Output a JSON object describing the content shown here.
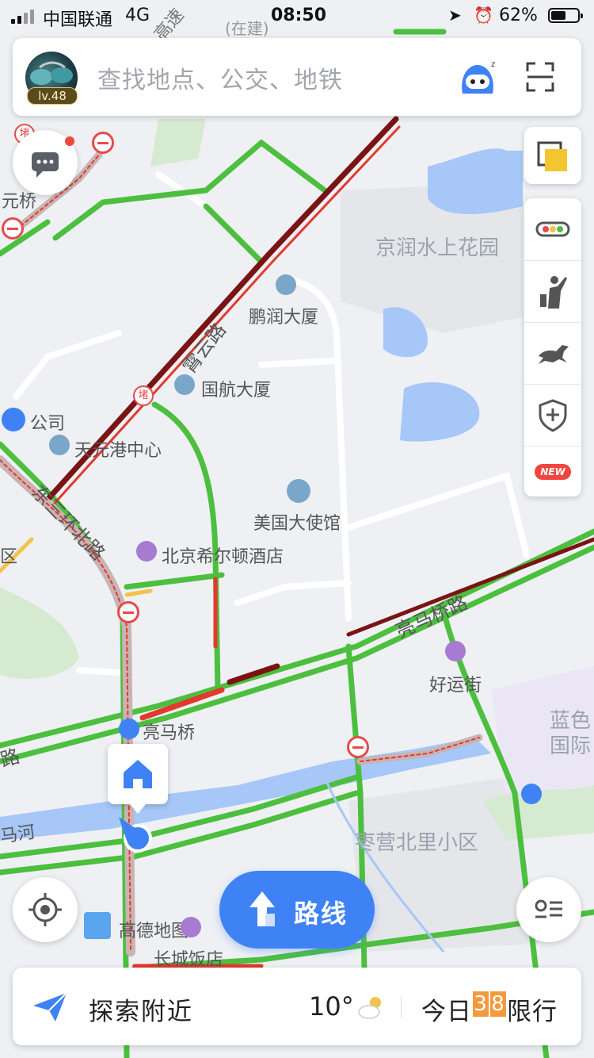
{
  "status_bar": {
    "carrier": "中国联通",
    "network": "4G",
    "time": "08:50",
    "battery_percent": "62%",
    "battery_level": 0.62
  },
  "search": {
    "placeholder": "查找地点、公交、地铁",
    "level_badge": "lv.48"
  },
  "map": {
    "road_labels": {
      "xiaoyun_road": "霄云路",
      "east_third_ring": "东三环北路",
      "liangmaqiao_road": "亮马桥路",
      "road_left": "路",
      "river": "马河",
      "top_left_qiao": "元桥",
      "top_speed": "高速",
      "construction": "(在建)",
      "left_qu": "区",
      "jam": "堵"
    },
    "pois": {
      "pengrun": "鹏润大厦",
      "guohang": "国航大厦",
      "company": "公司",
      "tianyuangang": "天元港中心",
      "us_embassy": "美国大使馆",
      "hilton": "北京希尔顿酒店",
      "haoyunjie": "好运街",
      "liangmaqiao_station": "亮马桥",
      "amap_label": "高德地图",
      "great_wall_hotel": "长城饭店"
    },
    "areas": {
      "jingrun": "京润水上花园",
      "zaoying": "枣营北里小区",
      "lanse_1": "蓝色",
      "lanse_2": "国际"
    },
    "colors": {
      "road_smooth": "#4cbf3f",
      "road_slow": "#e23a2e",
      "road_jam": "#7a1414",
      "water": "#a6c7f7",
      "park": "#d6ead2",
      "accent": "#3f82f6"
    }
  },
  "buttons": {
    "route_label": "路线",
    "message_icon": "chat-bubble-icon",
    "layers_icon": "layers-icon",
    "traffic_icon": "traffic-light-icon",
    "taxi_icon": "hail-taxi-icon",
    "horse_icon": "galloping-horse-icon",
    "shield_icon": "shield-plus-icon",
    "new_badge": "NEW",
    "location_icon": "locate-icon",
    "list_icon": "pin-list-icon",
    "home_icon": "home-icon"
  },
  "bottom_bar": {
    "explore": "探索附近",
    "temperature": "10°",
    "weather_icon": "partly-cloudy-icon",
    "restriction_prefix": "今日",
    "restriction_digit_1": "3",
    "restriction_digit_2": "8",
    "restriction_suffix": "限行"
  }
}
